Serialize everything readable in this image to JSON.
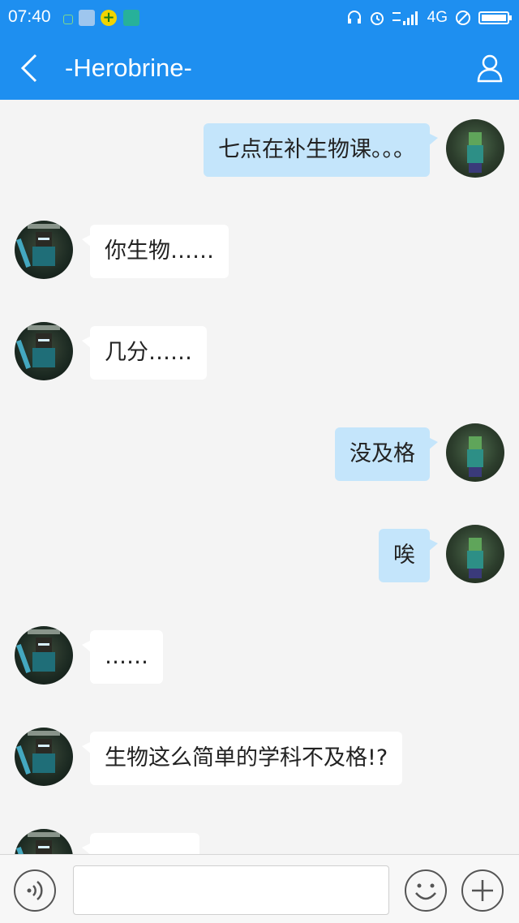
{
  "status_bar": {
    "time": "07:40",
    "network": "4G",
    "left_icons": [
      "sim-icon",
      "kuwo-icon",
      "plus-app-icon",
      "scan-icon"
    ],
    "right_icons": [
      "headset-icon",
      "alarm-icon",
      "signal-icon",
      "dnd-icon",
      "battery-icon"
    ]
  },
  "header": {
    "title": "-Herobrine-",
    "back_icon": "back-arrow-icon",
    "profile_icon": "person-icon"
  },
  "messages": [
    {
      "side": "self",
      "text": "七点在补生物课。。。"
    },
    {
      "side": "other",
      "text": "你生物……"
    },
    {
      "side": "other",
      "text": "几分……"
    },
    {
      "side": "self",
      "text": "没及格"
    },
    {
      "side": "self",
      "text": "唉"
    },
    {
      "side": "other",
      "text": "……"
    },
    {
      "side": "other",
      "text": "生物这么简单的学科不及格!?"
    },
    {
      "side": "other",
      "text": ""
    }
  ],
  "input_bar": {
    "placeholder": "",
    "value": "",
    "icons": [
      "voice-icon",
      "emoji-icon",
      "plus-icon"
    ]
  },
  "colors": {
    "header_blue": "#1e8ff0",
    "outgoing_bubble": "#c4e5fb",
    "incoming_bubble": "#ffffff",
    "chat_background": "#f4f4f4"
  }
}
